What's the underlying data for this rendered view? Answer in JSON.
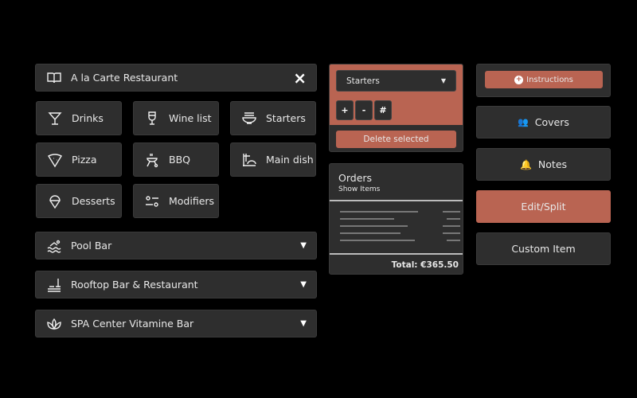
{
  "header": {
    "title": "A la Carte Restaurant",
    "close": "×"
  },
  "categories": [
    {
      "label": "Drinks",
      "icon": "cocktail-icon"
    },
    {
      "label": "Wine list",
      "icon": "wine-glass-icon"
    },
    {
      "label": "Starters",
      "icon": "bowl-icon"
    },
    {
      "label": "Pizza",
      "icon": "pizza-icon"
    },
    {
      "label": "BBQ",
      "icon": "bbq-grill-icon"
    },
    {
      "label": "Main dish",
      "icon": "main-dish-icon"
    },
    {
      "label": "Desserts",
      "icon": "ice-cream-icon"
    },
    {
      "label": "Modifiers",
      "icon": "sliders-icon"
    }
  ],
  "accordions": [
    {
      "label": "Pool Bar",
      "icon": "swimmer-icon"
    },
    {
      "label": "Rooftop Bar & Restaurant",
      "icon": "rooftop-bar-icon"
    },
    {
      "label": "SPA Center Vitamine Bar",
      "icon": "lotus-icon"
    }
  ],
  "controls": {
    "select_value": "Starters",
    "plus": "+",
    "minus": "-",
    "hash": "#",
    "delete": "Delete selected"
  },
  "orders": {
    "title": "Orders",
    "subtitle": "Show Items",
    "total": "Total: €365.50"
  },
  "actions": {
    "instructions": "Instructions",
    "covers": "Covers",
    "notes": "Notes",
    "edit_split": "Edit/Split",
    "custom_item": "Custom Item"
  },
  "colors": {
    "accent": "#b96452",
    "panel": "#2e2e2e"
  }
}
